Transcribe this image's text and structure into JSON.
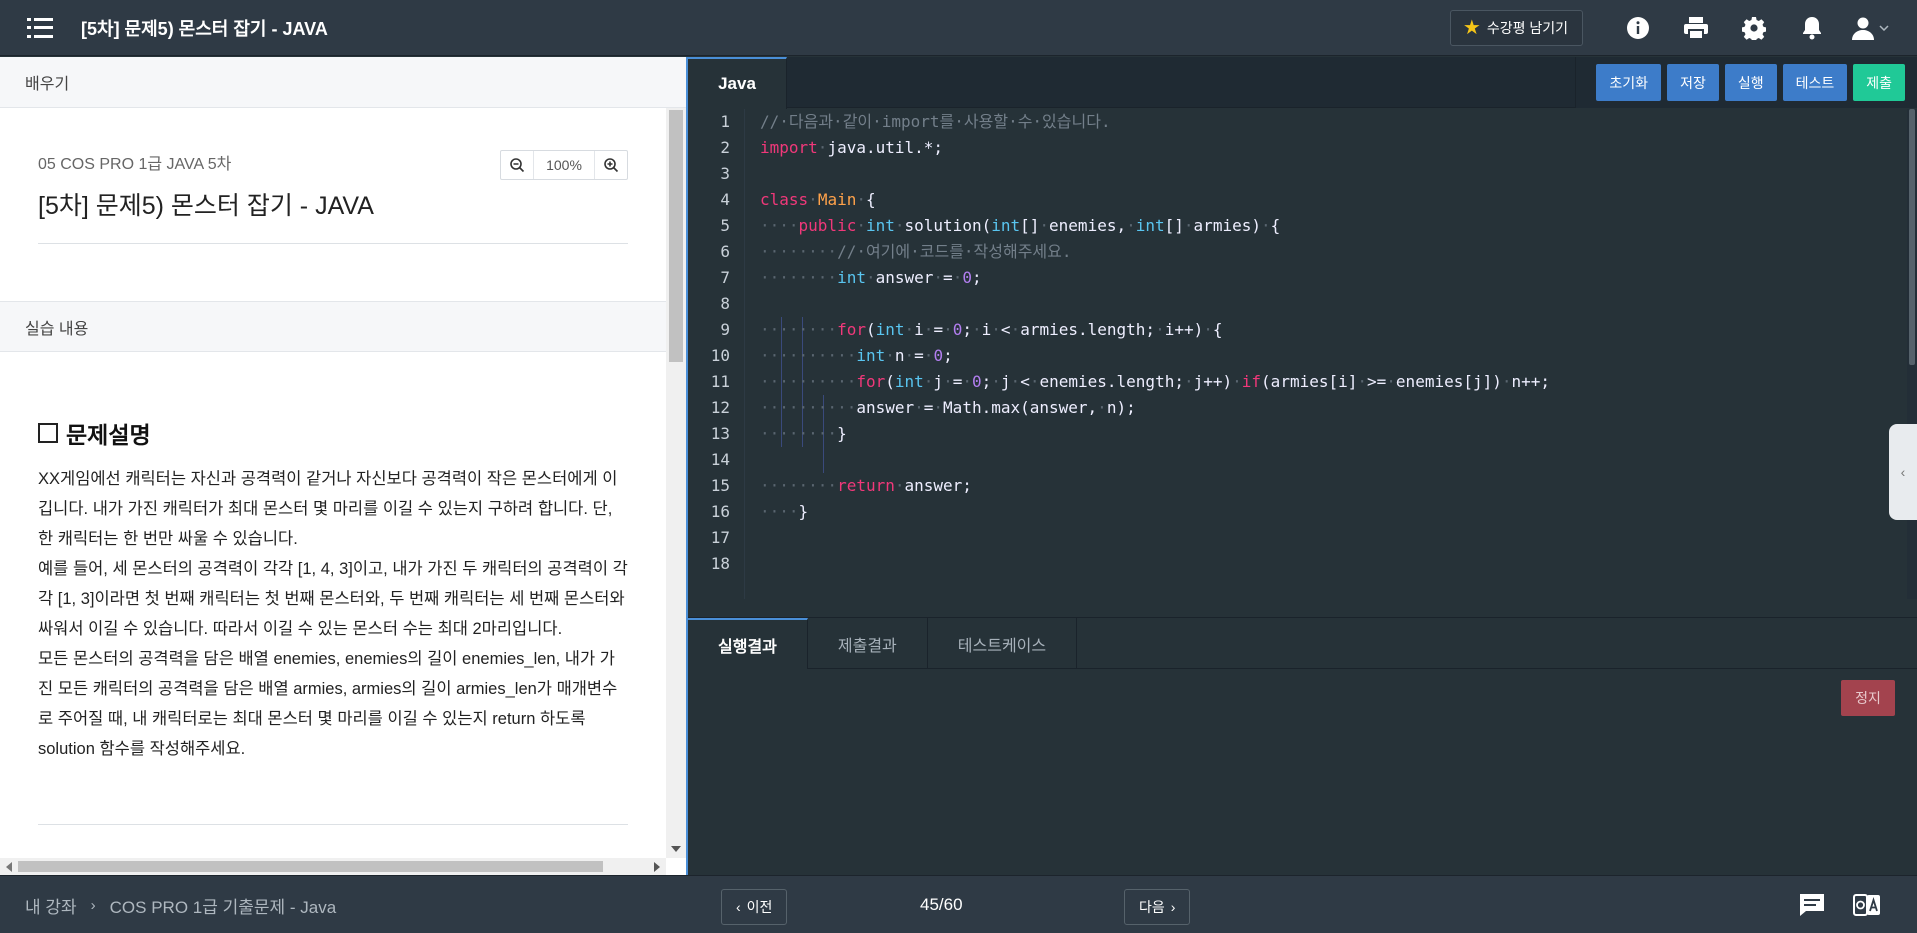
{
  "header": {
    "title": "[5차] 문제5) 몬스터 잡기 - JAVA",
    "review_button": "수강평 남기기"
  },
  "left": {
    "tab_label": "배우기",
    "lesson_subtitle": "05 COS PRO 1급 JAVA 5차",
    "lesson_title": "[5차] 문제5) 몬스터 잡기 - JAVA",
    "zoom": "100%",
    "practice_label": "실습 내용",
    "section_title": "문제설명",
    "description": [
      "XX게임에선 캐릭터는 자신과 공격력이 같거나 자신보다 공격력이 작은 몬스터에게 이깁니다. 내가 가진 캐릭터가 최대 몬스터 몇 마리를 이길 수 있는지 구하려 합니다. 단, 한 캐릭터는 한 번만 싸울 수 있습니다.",
      "예를 들어, 세 몬스터의 공격력이 각각 [1, 4, 3]이고, 내가 가진 두 캐릭터의 공격력이 각각 [1, 3]이라면 첫 번째 캐릭터는 첫 번째 몬스터와, 두 번째 캐릭터는 세 번째 몬스터와 싸워서 이길 수 있습니다. 따라서 이길 수 있는 몬스터 수는 최대 2마리입니다.",
      "모든 몬스터의 공격력을 담은 배열 enemies, enemies의 길이 enemies_len, 내가 가진 모든 캐릭터의 공격력을 담은 배열 armies, armies의 길이 armies_len가 매개변수로 주어질 때, 내 캐릭터로는 최대 몬스터 몇 마리를 이길 수 있는지 return 하도록 solution 함수를 작성해주세요."
    ]
  },
  "editor": {
    "language_tab": "Java",
    "actions": [
      "초기화",
      "저장",
      "실행",
      "테스트",
      "제출"
    ],
    "line_numbers": [
      "1",
      "2",
      "3",
      "4",
      "5",
      "6",
      "7",
      "8",
      "9",
      "10",
      "11",
      "12",
      "13",
      "14",
      "15",
      "16",
      "17",
      "18"
    ],
    "code": [
      "// 다음과 같이 import를 사용할 수 있습니다.",
      "import java.util.*;",
      "",
      "class Main {",
      "    public int solution(int[] enemies, int[] armies) {",
      "        // 여기에 코드를 작성해주세요.",
      "        int answer = 0;",
      "",
      "        for(int i = 0; i < armies.length; i++) {",
      "          int n = 0;",
      "          for(int j = 0; j < enemies.length; j++) if(armies[i] >= enemies[j]) n++;",
      "          answer = Math.max(answer, n);",
      "        }",
      "",
      "        return answer;",
      "    }",
      "",
      ""
    ],
    "result_tabs": [
      "실행결과",
      "제출결과",
      "테스트케이스"
    ],
    "stop_button": "정지"
  },
  "footer": {
    "breadcrumb_root": "내 강좌",
    "breadcrumb_course": "COS PRO 1급 기출문제 - Java",
    "prev_label": "이전",
    "page_indicator": "45/60",
    "next_label": "다음"
  },
  "colors": {
    "accent_blue": "#3d7cc9",
    "submit_green": "#20c997",
    "stop_red": "#a3434e",
    "topbar_bg": "#2f3a45",
    "editor_bg": "#263238"
  },
  "icons": [
    "menu-icon",
    "star-icon",
    "info-icon",
    "print-icon",
    "gear-icon",
    "bell-icon",
    "user-icon",
    "zoom-out-icon",
    "zoom-in-icon",
    "chat-icon",
    "translate-icon"
  ]
}
